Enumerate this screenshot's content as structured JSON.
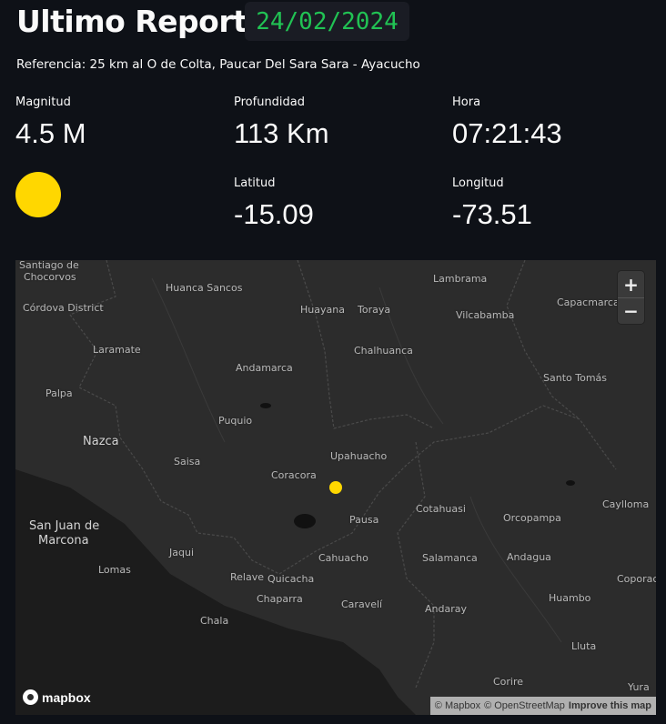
{
  "header": {
    "title": "Ultimo Reporte:",
    "date": "24/02/2024"
  },
  "reference": "Referencia: 25 km al O de Colta, Paucar Del Sara Sara - Ayacucho",
  "metrics": {
    "magnitude": {
      "label": "Magnitud",
      "value": "4.5 M"
    },
    "depth": {
      "label": "Profundidad",
      "value": "113 Km"
    },
    "time": {
      "label": "Hora",
      "value": "07:21:43"
    },
    "latitude": {
      "label": "Latitud",
      "value": "-15.09"
    },
    "longitude": {
      "label": "Longitud",
      "value": "-73.51"
    }
  },
  "colors": {
    "magnitude_dot": "#ffd700",
    "date_text": "#21c354",
    "background": "#0e1117"
  },
  "map": {
    "places": [
      "Santiago de",
      "Chocorvos",
      "Córdova District",
      "Huanca Sancos",
      "Lambrama",
      "Capacmarca",
      "Huayana",
      "Toraya",
      "Vilcabamba",
      "Laramate",
      "Chalhuanca",
      "Andamarca",
      "Santo Tomás",
      "Palpa",
      "Puquio",
      "Nazca",
      "Upahuacho",
      "Saisa",
      "Coracora",
      "Cotahuasi",
      "Caylloma",
      "Orcopampa",
      "Pausa",
      "San Juan de",
      "Marcona",
      "Jaqui",
      "Cahuacho",
      "Salamanca",
      "Andagua",
      "Lomas",
      "Relave",
      "Quicacha",
      "Coporac",
      "Chaparra",
      "Caravelí",
      "Andaray",
      "Huambo",
      "Chala",
      "Lluta",
      "Corire",
      "Yura"
    ],
    "zoom_in": "+",
    "zoom_out": "−",
    "logo_text": "mapbox",
    "logo_icon": "mapbox-logo-icon",
    "attribution": {
      "mapbox": "© Mapbox",
      "osm": "© OpenStreetMap",
      "improve": "Improve this map"
    }
  }
}
